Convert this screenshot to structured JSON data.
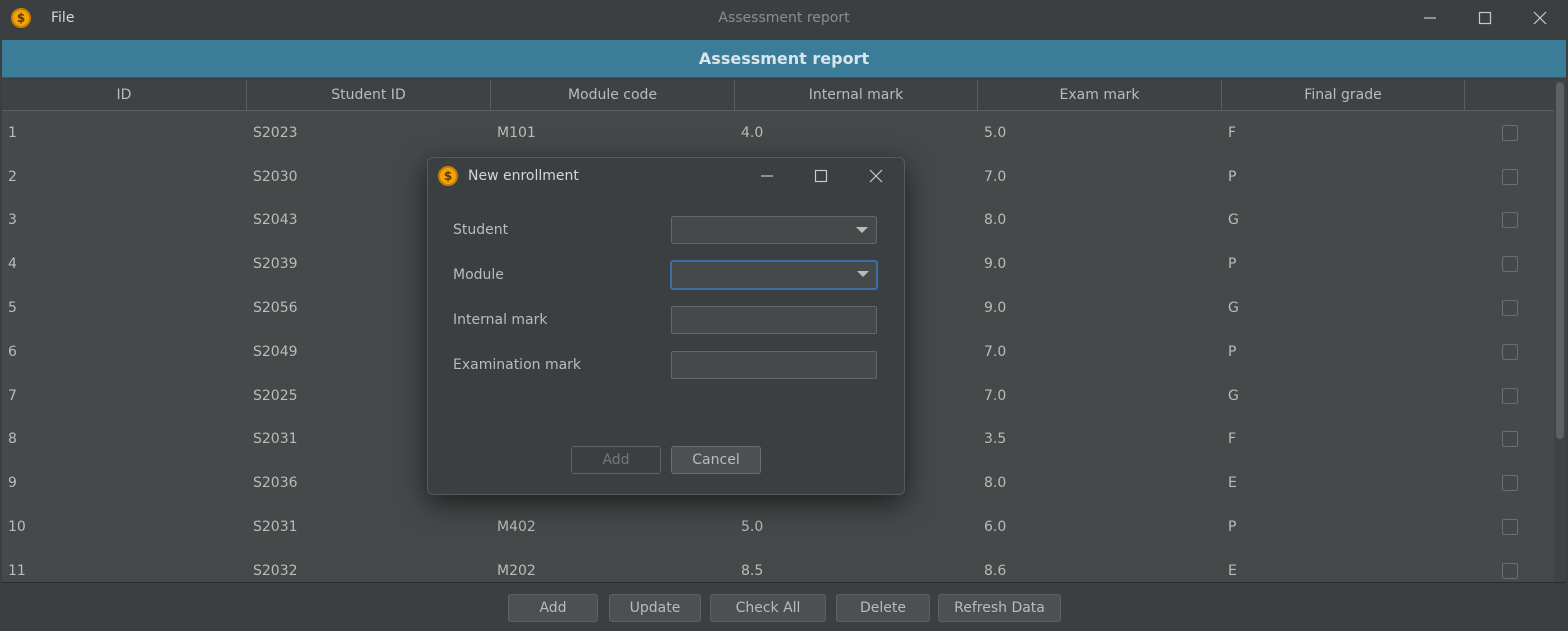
{
  "window": {
    "title": "Assessment report",
    "menu": [
      "File"
    ]
  },
  "header": {
    "title": "Assessment report"
  },
  "table": {
    "columns": [
      "ID",
      "Student ID",
      "Module code",
      "Internal mark",
      "Exam mark",
      "Final grade",
      ""
    ],
    "rows": [
      {
        "id": "1",
        "student": "S2023",
        "module": "M101",
        "internal": "4.0",
        "exam": "5.0",
        "grade": "F",
        "checked": false
      },
      {
        "id": "2",
        "student": "S2030",
        "module": "",
        "internal": "",
        "exam": "7.0",
        "grade": "P",
        "checked": false
      },
      {
        "id": "3",
        "student": "S2043",
        "module": "",
        "internal": "",
        "exam": "8.0",
        "grade": "G",
        "checked": false
      },
      {
        "id": "4",
        "student": "S2039",
        "module": "",
        "internal": "",
        "exam": "9.0",
        "grade": "P",
        "checked": false
      },
      {
        "id": "5",
        "student": "S2056",
        "module": "",
        "internal": "",
        "exam": "9.0",
        "grade": "G",
        "checked": false
      },
      {
        "id": "6",
        "student": "S2049",
        "module": "",
        "internal": "",
        "exam": "7.0",
        "grade": "P",
        "checked": false
      },
      {
        "id": "7",
        "student": "S2025",
        "module": "",
        "internal": "",
        "exam": "7.0",
        "grade": "G",
        "checked": false
      },
      {
        "id": "8",
        "student": "S2031",
        "module": "",
        "internal": "",
        "exam": "3.5",
        "grade": "F",
        "checked": false
      },
      {
        "id": "9",
        "student": "S2036",
        "module": "",
        "internal": "",
        "exam": "8.0",
        "grade": "E",
        "checked": false
      },
      {
        "id": "10",
        "student": "S2031",
        "module": "M402",
        "internal": "5.0",
        "exam": "6.0",
        "grade": "P",
        "checked": false
      },
      {
        "id": "11",
        "student": "S2032",
        "module": "M202",
        "internal": "8.5",
        "exam": "8.6",
        "grade": "E",
        "checked": false
      }
    ]
  },
  "buttons": {
    "add": "Add",
    "update": "Update",
    "check_all": "Check All",
    "delete": "Delete",
    "refresh": "Refresh Data"
  },
  "dialog": {
    "title": "New enrollment",
    "fields": {
      "student": {
        "label": "Student",
        "value": ""
      },
      "module": {
        "label": "Module",
        "value": ""
      },
      "internal": {
        "label": "Internal mark",
        "value": ""
      },
      "exam": {
        "label": "Examination mark",
        "value": ""
      }
    },
    "add_label": "Add",
    "cancel_label": "Cancel"
  },
  "icons": {
    "app": "coin-dollar-icon",
    "minimize": "minimize-icon",
    "maximize": "maximize-icon",
    "close": "close-icon",
    "dropdown": "chevron-down-icon"
  },
  "colors": {
    "header_band": "#3b7d98",
    "background": "#3c3f41",
    "focus_border": "#3d6fa6",
    "coin": "#f2a20a"
  }
}
